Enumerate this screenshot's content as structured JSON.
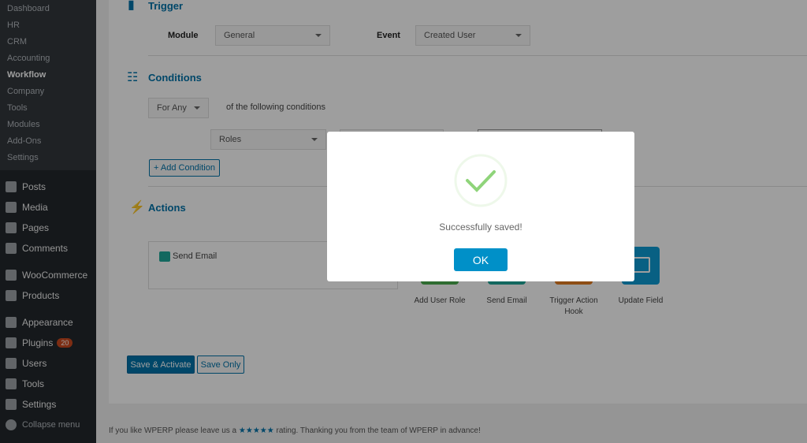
{
  "sidebar": {
    "submenu": [
      "Dashboard",
      "HR",
      "CRM",
      "Accounting",
      "Workflow",
      "Company",
      "Tools",
      "Modules",
      "Add-Ons",
      "Settings"
    ],
    "current": "Workflow",
    "menu": [
      {
        "label": "Posts",
        "icon": "pin-icon"
      },
      {
        "label": "Media",
        "icon": "media-icon"
      },
      {
        "label": "Pages",
        "icon": "pages-icon"
      },
      {
        "label": "Comments",
        "icon": "comment-icon"
      },
      {
        "label": "WooCommerce",
        "icon": "woo-icon"
      },
      {
        "label": "Products",
        "icon": "box-icon"
      },
      {
        "label": "Appearance",
        "icon": "brush-icon"
      },
      {
        "label": "Plugins",
        "icon": "plug-icon",
        "badge": "20"
      },
      {
        "label": "Users",
        "icon": "user-icon"
      },
      {
        "label": "Tools",
        "icon": "wrench-icon"
      },
      {
        "label": "Settings",
        "icon": "settings-icon"
      },
      {
        "label": "Collapse menu",
        "icon": "collapse-icon"
      }
    ]
  },
  "trigger": {
    "title": "Trigger",
    "module_label": "Module",
    "module_value": "General",
    "event_label": "Event",
    "event_value": "Created User"
  },
  "conditions": {
    "title": "Conditions",
    "match_value": "For Any",
    "match_text": "of the following conditions",
    "field_value": "Roles",
    "add_label": "+ Add Condition"
  },
  "actions": {
    "title": "Actions",
    "selected": "Send Email",
    "tiles": [
      {
        "label": "Add User Role",
        "color": "#4caf50"
      },
      {
        "label": "Send Email",
        "color": "#1fa99a"
      },
      {
        "label": "Trigger Action Hook",
        "color": "#e67e22"
      },
      {
        "label": "Update Field",
        "color": "#0e9bd3"
      }
    ]
  },
  "buttons": {
    "save_activate": "Save & Activate",
    "save_only": "Save Only"
  },
  "footer": {
    "before": "If you like WPERP please leave us a ",
    "stars": "★★★★★",
    "after": " rating. Thanking you from the team of WPERP in advance!"
  },
  "modal": {
    "message": "Successfully saved!",
    "ok": "OK",
    "check_color": "#8fd47a"
  },
  "colors": {
    "accent": "#0073aa",
    "ok_button": "#0090c8"
  }
}
